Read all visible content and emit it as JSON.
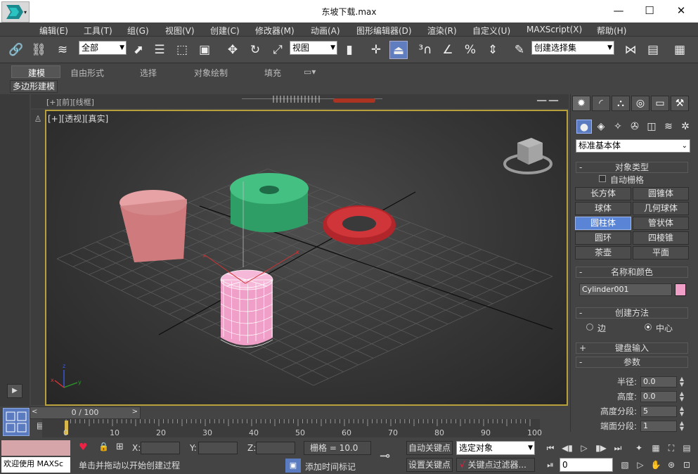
{
  "window": {
    "title": "东坡下载.max",
    "min": "—",
    "max": "☐",
    "close": "✕"
  },
  "menu": [
    "编辑(E)",
    "工具(T)",
    "组(G)",
    "视图(V)",
    "创建(C)",
    "修改器(M)",
    "动画(A)",
    "图形编辑器(D)",
    "渲染(R)",
    "自定义(U)",
    "MAXScript(X)",
    "帮助(H)"
  ],
  "toolbar": {
    "selection_filter": "全部",
    "ref_coord": "视图",
    "named_selection": "创建选择集"
  },
  "ribbon": {
    "tabs": [
      "建模",
      "自由形式",
      "选择",
      "对象绘制",
      "填充"
    ],
    "active_panel": "多边形建模"
  },
  "viewport": {
    "label": "[+][透视][真实]",
    "top_label": "[+][前][线框]",
    "view_cube_face": ""
  },
  "cmdpanel": {
    "category": "标准基本体",
    "rollout_object_type": "对象类型",
    "autogrid_label": "自动栅格",
    "object_buttons": [
      "长方体",
      "圆锥体",
      "球体",
      "几何球体",
      "圆柱体",
      "管状体",
      "圆环",
      "四棱锥",
      "茶壶",
      "平面"
    ],
    "selected_button": "圆柱体",
    "rollout_name_color": "名称和颜色",
    "object_name": "Cylinder001",
    "object_color": "#f0a0c8",
    "rollout_creation": "创建方法",
    "creation_edge": "边",
    "creation_center": "中心",
    "rollout_keyboard": "键盘输入",
    "rollout_params": "参数",
    "params": [
      {
        "label": "半径:",
        "value": "0.0"
      },
      {
        "label": "高度:",
        "value": "0.0"
      },
      {
        "label": "高度分段:",
        "value": "5"
      },
      {
        "label": "端面分段:",
        "value": "1"
      }
    ]
  },
  "timeline": {
    "slider": "0 / 100",
    "ticks": [
      "0",
      "10",
      "20",
      "30",
      "40",
      "50",
      "60",
      "70",
      "80",
      "90",
      "100"
    ]
  },
  "status": {
    "welcome": "欢迎使用 MAXSc",
    "prompt": "单击并拖动以开始创建过程",
    "x_label": "X:",
    "y_label": "Y:",
    "z_label": "Z:",
    "grid": "栅格 = 10.0",
    "add_time_tag": "添加时间标记",
    "auto_key": "自动关键点",
    "set_key": "设置关键点",
    "selected_object": "选定对象",
    "key_filters": "关键点过滤器...",
    "frame": "0"
  },
  "colors": {
    "accent_blue": "#5a84d6",
    "viewport_border": "#b8a13a",
    "box_pink": "#e08a8c",
    "torus_red": "#c0292c",
    "tube_green": "#3fb97b"
  }
}
